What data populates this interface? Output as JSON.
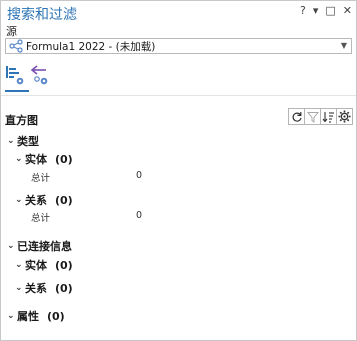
{
  "titlebar": {
    "title": "搜索和过滤",
    "help": "?",
    "menu": "▾",
    "pin": "□",
    "close": "✕"
  },
  "source": {
    "label": "源",
    "selected": "Formula1 2022 - (未加载)"
  },
  "histogram": {
    "title": "直方图",
    "tree": [
      {
        "label": "类型",
        "children": [
          {
            "label": "实体",
            "count": "(0)",
            "stat_label": "总计",
            "stat_value": "0"
          },
          {
            "label": "关系",
            "count": "(0)",
            "stat_label": "总计",
            "stat_value": "0"
          }
        ]
      },
      {
        "label": "已连接信息",
        "children": [
          {
            "label": "实体",
            "count": "(0)"
          },
          {
            "label": "关系",
            "count": "(0)"
          }
        ]
      },
      {
        "label": "属性",
        "count": "(0)"
      }
    ]
  }
}
